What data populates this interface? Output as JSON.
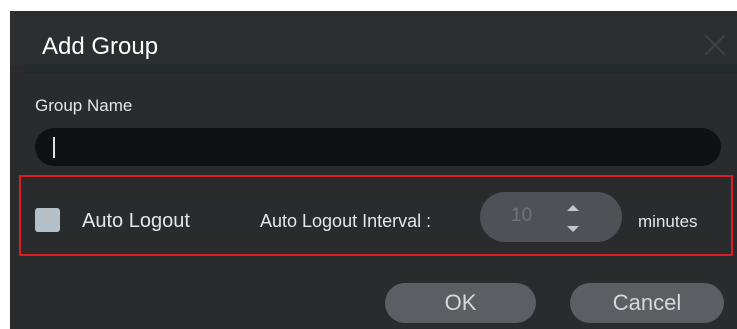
{
  "dialog": {
    "title": "Add Group",
    "close_icon": "close-icon"
  },
  "group_name": {
    "label": "Group Name",
    "value": ""
  },
  "auto_logout": {
    "checkbox_label": "Auto Logout",
    "checked": false,
    "interval_label": "Auto Logout Interval :",
    "interval_value": "10",
    "units_label": "minutes",
    "up_icon": "arrow-up-icon",
    "down_icon": "arrow-down-icon"
  },
  "buttons": {
    "ok_label": "OK",
    "cancel_label": "Cancel"
  },
  "colors": {
    "highlight": "#e01b24",
    "dialog_bg": "#292b2c",
    "input_bg": "#0f1112",
    "button_bg": "#5b5f63"
  }
}
